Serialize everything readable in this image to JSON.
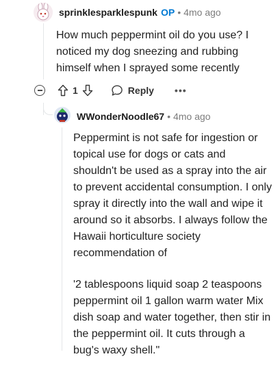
{
  "op_comment": {
    "username": "sprinklesparklespunk",
    "badge": "OP",
    "separator": "•",
    "time": "4mo ago",
    "body": "How much peppermint oil do you use? I noticed my dog sneezing and rubbing himself when I sprayed some recently",
    "actions": {
      "vote_count": "1",
      "reply_label": "Reply",
      "more_label": "•••"
    }
  },
  "reply_comment": {
    "username": "WWonderNoodle67",
    "separator": "•",
    "time": "4mo ago",
    "paragraphs": [
      "Peppermint is not safe for ingestion or topical use for dogs or cats and shouldn't be used as a spray into the air to prevent accidental consumption. I only spray it directly into the wall and wipe it around so it absorbs. I always follow the Hawaii horticulture society recommendation of",
      "'2 tablespoons liquid soap 2 teaspoons peppermint oil 1 gallon warm water Mix dish soap and water together, then stir in the peppermint oil. It cuts through a bug's waxy shell.\""
    ]
  },
  "colors": {
    "op_badge": "#0079d3",
    "meta_text": "#7c7c7c",
    "thread_line": "#e4e6e8"
  },
  "icons": [
    "collapse-icon",
    "upvote-icon",
    "downvote-icon",
    "reply-icon",
    "more-options-icon"
  ]
}
